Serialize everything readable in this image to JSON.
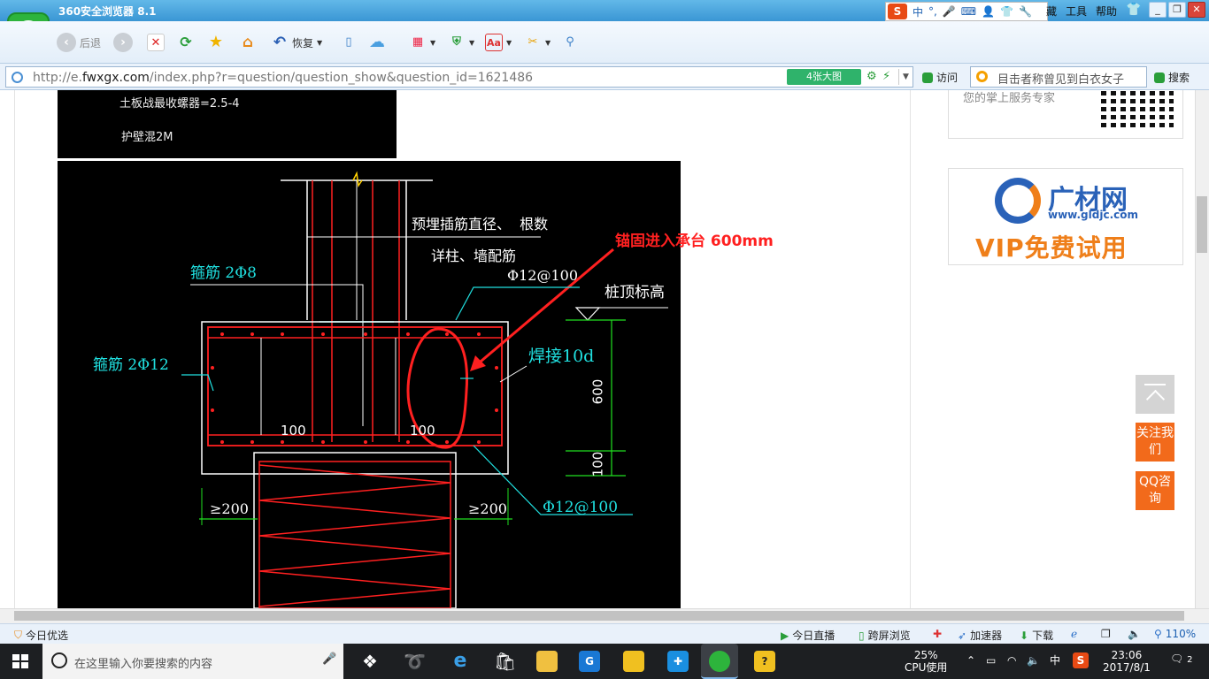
{
  "window": {
    "title": "360安全浏览器 8.1",
    "menu": [
      "藏",
      "工具",
      "帮助"
    ],
    "ime_label": "中"
  },
  "toolbar": {
    "back_label": "后退",
    "restore_label": "恢复"
  },
  "address": {
    "url_prefix": "http://e.",
    "url_domain": "fwxgx.com",
    "url_rest": "/index.php?r=question/question_show&question_id=1621486",
    "big_pic_label": "4张大图",
    "visit_label": "访问",
    "search_value": "目击者称曾见到白衣女子",
    "search_button": "搜索"
  },
  "page": {
    "top_image_line1": "土板战最收螺器=2.5-4",
    "top_image_line2": "护壁混2M",
    "cad": {
      "annotation_red": "锚固进入承台 600mm",
      "label_embed": "预埋插筋直径、  根数",
      "label_detail": "详柱、墙配筋",
      "label_stirrup8": "箍筋 2Φ8",
      "label_stirrup12": "箍筋 2Φ12",
      "label_rebar_top": "Φ12@100",
      "label_pile_top": "桩顶标高",
      "label_weld": "焊接10d",
      "label_600": "600",
      "label_100_left": "100",
      "label_100_mid": "100",
      "label_100_right": "100",
      "label_ge200_left": "≥200",
      "label_ge200_right": "≥200",
      "label_rebar_bottom": "Φ12@100"
    },
    "side": {
      "qr_text": "您的掌上服务专家",
      "ad_brand": "广材网",
      "ad_site": "www.gldjc.com",
      "ad_vip": "VIP免费试用",
      "follow_label": "关注我们",
      "qq_label": "QQ咨询"
    }
  },
  "statusbar": {
    "left": "今日优选",
    "live": "今日直播",
    "cross_screen": "跨屏浏览",
    "accelerator": "加速器",
    "download": "下载",
    "zoom": "110%"
  },
  "taskbar": {
    "search_placeholder": "在这里输入你要搜索的内容",
    "cpu_percent": "25%",
    "cpu_label": "CPU使用",
    "ime": "中",
    "time": "23:06",
    "date": "2017/8/1",
    "notifications": "2"
  },
  "colors": {
    "accent": "#3a96d4",
    "cad_red": "#ff2020",
    "cad_cyan": "#20e0e0",
    "cad_green": "#20e020",
    "orange": "#f26a1b"
  }
}
